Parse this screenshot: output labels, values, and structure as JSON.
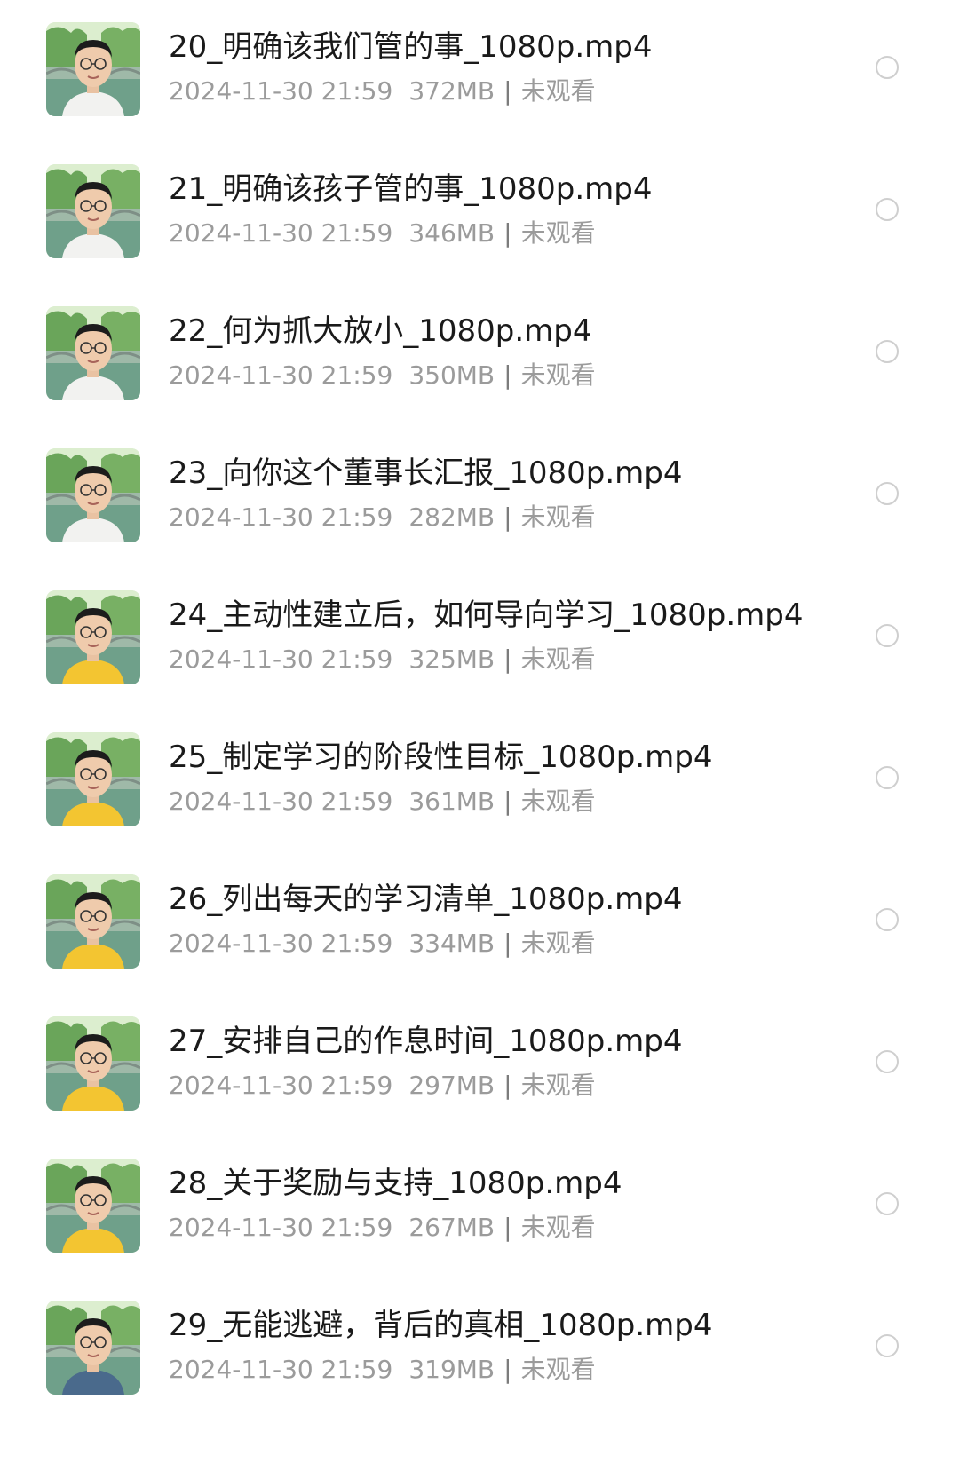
{
  "files": [
    {
      "name": "20_明确该我们管的事_1080p.mp4",
      "date": "2024-11-30 21:59",
      "size": "372MB",
      "status": "未观看",
      "shirt": "white"
    },
    {
      "name": "21_明确该孩子管的事_1080p.mp4",
      "date": "2024-11-30 21:59",
      "size": "346MB",
      "status": "未观看",
      "shirt": "white"
    },
    {
      "name": "22_何为抓大放小_1080p.mp4",
      "date": "2024-11-30 21:59",
      "size": "350MB",
      "status": "未观看",
      "shirt": "white"
    },
    {
      "name": "23_向你这个董事长汇报_1080p.mp4",
      "date": "2024-11-30 21:59",
      "size": "282MB",
      "status": "未观看",
      "shirt": "white"
    },
    {
      "name": "24_主动性建立后，如何导向学习_1080p.mp4",
      "date": "2024-11-30 21:59",
      "size": "325MB",
      "status": "未观看",
      "shirt": "yellow"
    },
    {
      "name": "25_制定学习的阶段性目标_1080p.mp4",
      "date": "2024-11-30 21:59",
      "size": "361MB",
      "status": "未观看",
      "shirt": "yellow"
    },
    {
      "name": "26_列出每天的学习清单_1080p.mp4",
      "date": "2024-11-30 21:59",
      "size": "334MB",
      "status": "未观看",
      "shirt": "yellow"
    },
    {
      "name": "27_安排自己的作息时间_1080p.mp4",
      "date": "2024-11-30 21:59",
      "size": "297MB",
      "status": "未观看",
      "shirt": "yellow"
    },
    {
      "name": "28_关于奖励与支持_1080p.mp4",
      "date": "2024-11-30 21:59",
      "size": "267MB",
      "status": "未观看",
      "shirt": "yellow"
    },
    {
      "name": "29_无能逃避，背后的真相_1080p.mp4",
      "date": "2024-11-30 21:59",
      "size": "319MB",
      "status": "未观看",
      "shirt": "blue"
    }
  ],
  "colors": {
    "title_text": "#1a1a1a",
    "meta_text": "#9b9b9b",
    "radio_border": "#cfcfcf",
    "shirt_white": "#f2f2f0",
    "shirt_yellow": "#f3c531",
    "shirt_blue": "#4a6a8c"
  }
}
